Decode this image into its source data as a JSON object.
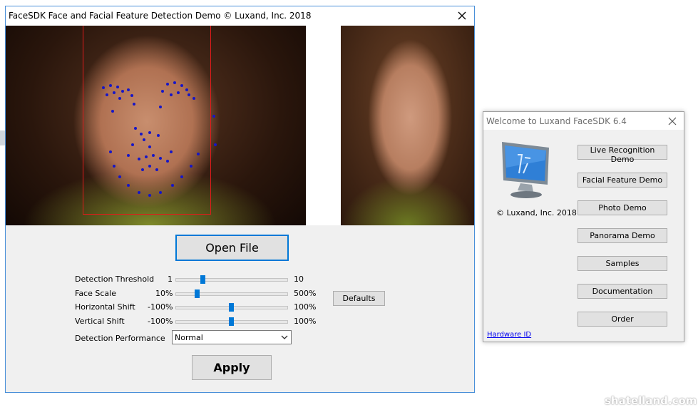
{
  "main_window": {
    "title": "FaceSDK Face and Facial Feature Detection Demo © Luxand, Inc. 2018",
    "open_file_label": "Open File",
    "apply_label": "Apply",
    "defaults_label": "Defaults",
    "sliders": [
      {
        "label": "Detection Threshold",
        "min": "1",
        "max": "10",
        "position": 0.23
      },
      {
        "label": "Face Scale",
        "min": "10%",
        "max": "500%",
        "position": 0.18
      },
      {
        "label": "Horizontal Shift",
        "min": "-100%",
        "max": "100%",
        "position": 0.5
      },
      {
        "label": "Vertical Shift",
        "min": "-100%",
        "max": "100%",
        "position": 0.5
      }
    ],
    "performance": {
      "label": "Detection Performance",
      "value": "Normal"
    }
  },
  "welcome_window": {
    "title": "Welcome to Luxand FaceSDK 6.4",
    "copyright": "© Luxand, Inc. 2018",
    "buttons": [
      "Live Recognition Demo",
      "Facial Feature Demo",
      "Photo Demo",
      "Panorama Demo",
      "Samples",
      "Documentation",
      "Order"
    ],
    "hardware_id_label": "Hardware ID"
  },
  "watermark": "shatelland.com",
  "colors": {
    "accent": "#0078d7",
    "face_box": "#e01b1b",
    "feature_points": "#1616c8"
  },
  "icons": {
    "close": "close-icon",
    "dropdown": "chevron-down-icon",
    "monitor": "monitor-icon"
  }
}
